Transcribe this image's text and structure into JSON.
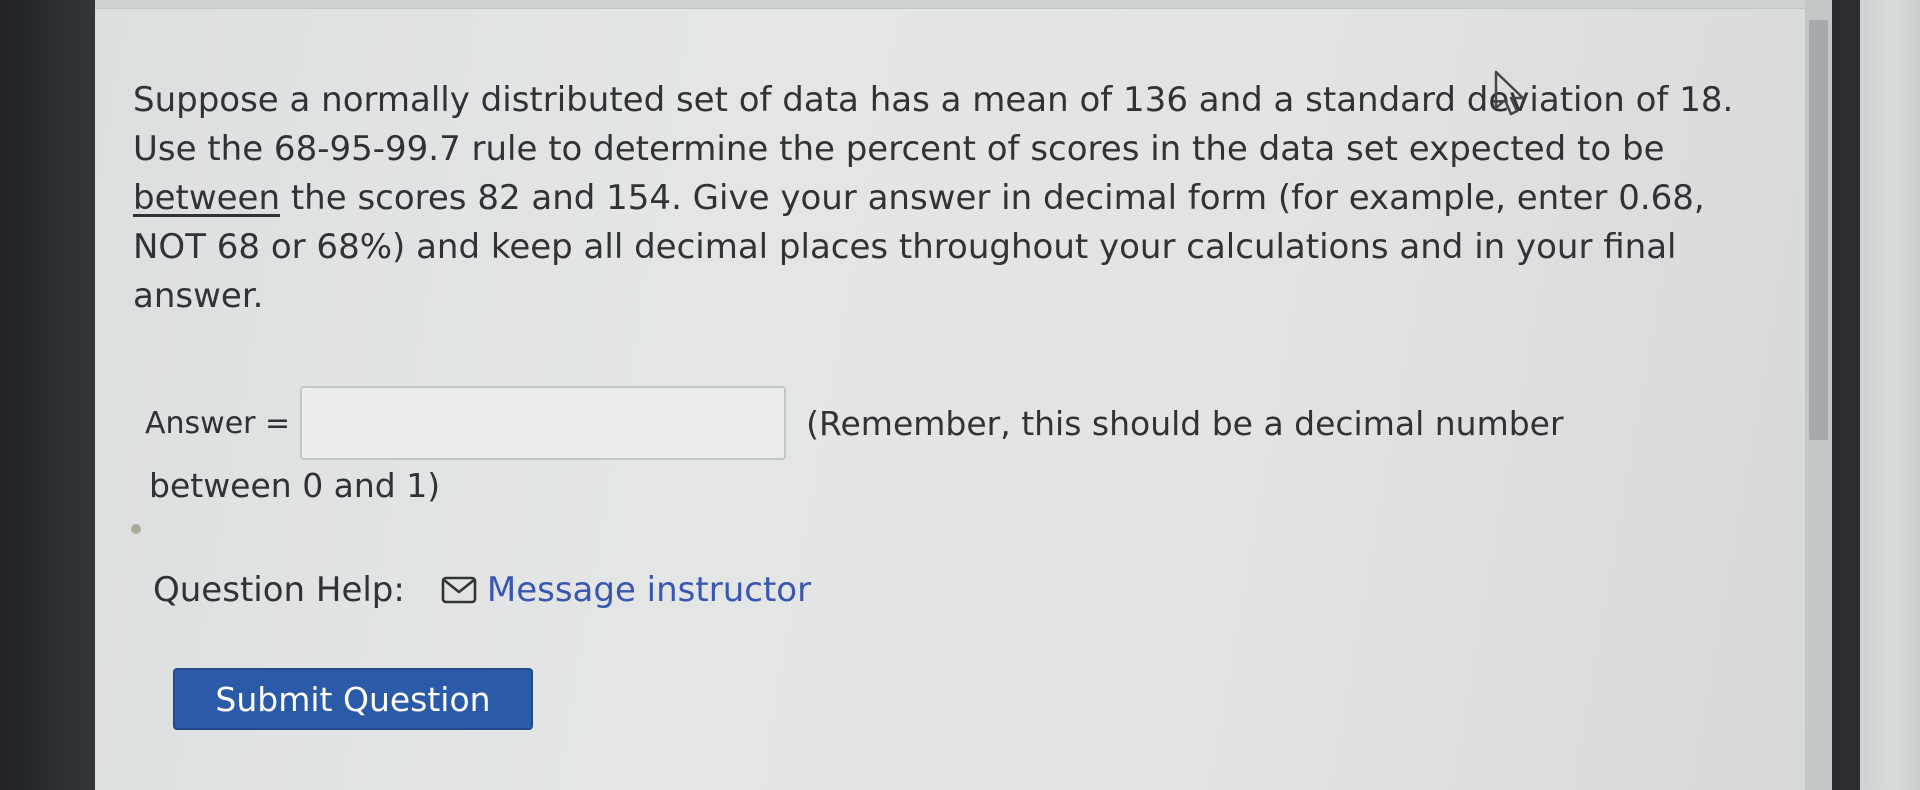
{
  "question": {
    "part1": "Suppose a normally distributed set of data has a mean of 136 and a standard deviation of 18. Use the 68-95-99.7 rule to determine the percent of scores in the data set expected to be ",
    "emphasis": "between",
    "part2": " the scores 82 and 154. Give your answer in decimal form (for example, enter 0.68, NOT 68 or 68%) and keep all decimal places throughout your calculations and in your final answer."
  },
  "answer": {
    "label": "Answer =",
    "value": "",
    "hint": "(Remember, this should be a decimal number",
    "hint_cont": "between 0 and 1)"
  },
  "help": {
    "label": "Question Help:",
    "link": "Message instructor",
    "icon": "envelope-icon"
  },
  "submit": {
    "label": "Submit Question",
    "color": "#2a5aa8"
  },
  "colors": {
    "text": "#303236",
    "link": "#3a56b0"
  }
}
